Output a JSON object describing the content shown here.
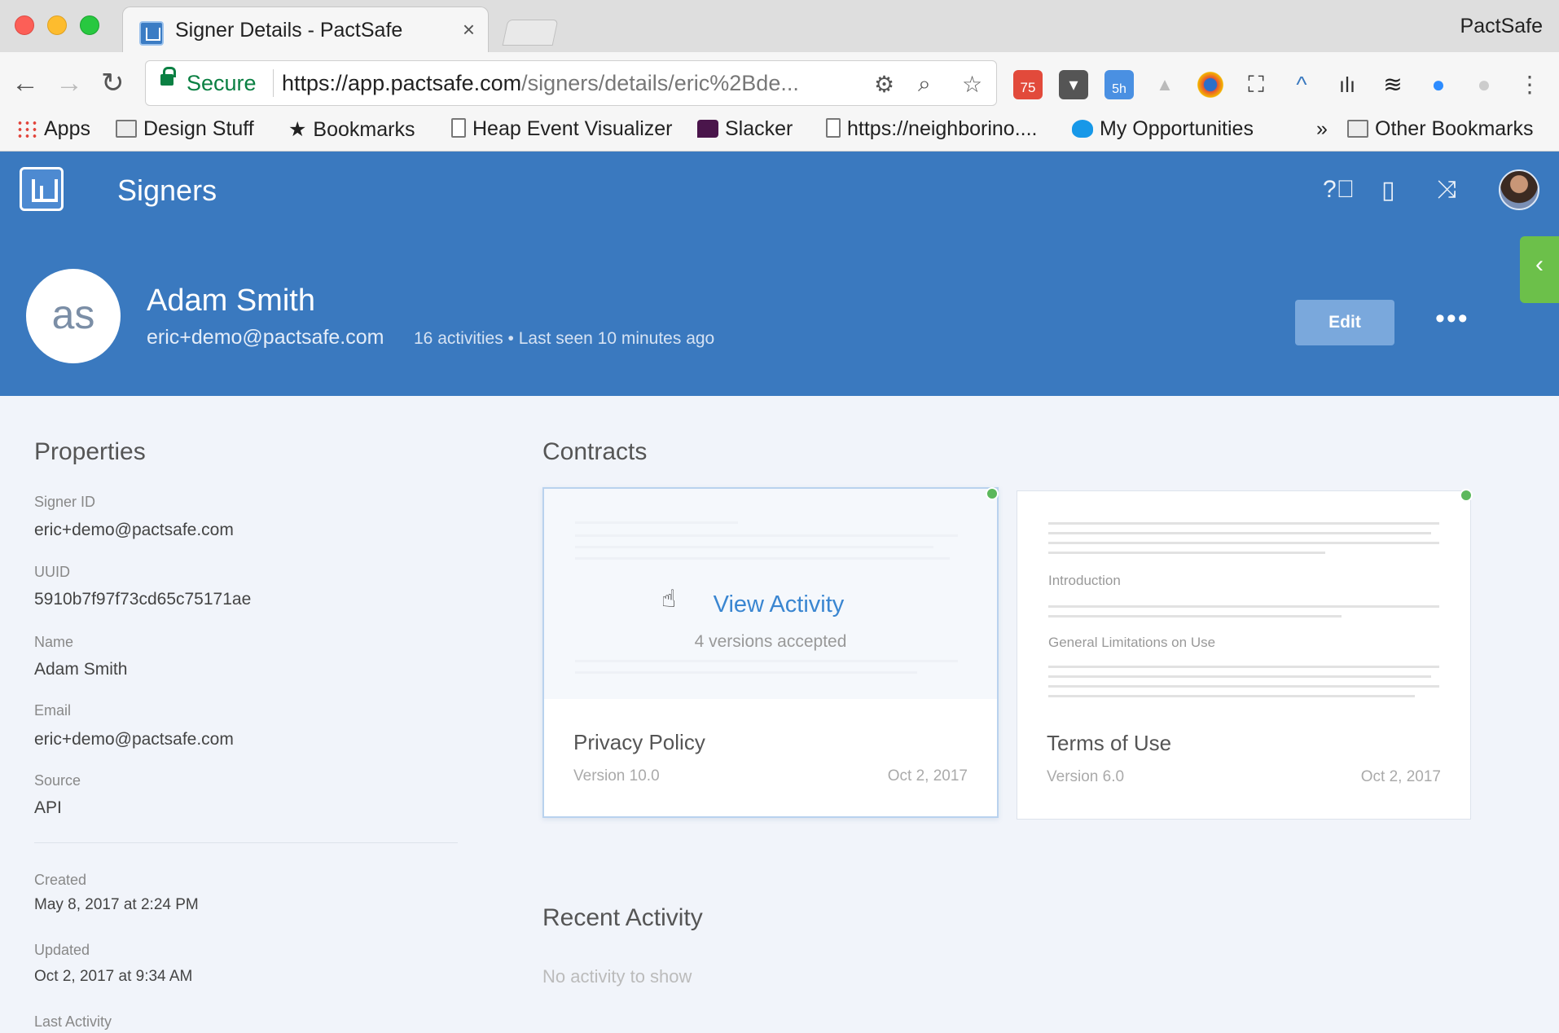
{
  "browser": {
    "tab_title": "Signer Details - PactSafe",
    "tab_close": "×",
    "profile_name": "PactSafe",
    "secure_label": "Secure",
    "url_host": "https://app.pactsafe.com",
    "url_path": "/signers/details/eric%2Bde...",
    "extension_badge_calendar": "75",
    "extension_badge_timer": "5h",
    "bookmarks": {
      "apps": "Apps",
      "design": "Design Stuff",
      "bookmarks": "Bookmarks",
      "heap": "Heap Event Visualizer",
      "slacker": "Slacker",
      "neighbor": "https://neighborino....",
      "opps": "My Opportunities",
      "overflow": "»",
      "other": "Other Bookmarks"
    }
  },
  "app": {
    "title": "Signers",
    "brand_color": "#3a79bf"
  },
  "profile": {
    "initials": "as",
    "name": "Adam Smith",
    "email": "eric+demo@pactsafe.com",
    "meta": "16 activities  •  Last seen 10 minutes ago",
    "edit_label": "Edit",
    "more_label": "•••"
  },
  "properties": {
    "title": "Properties",
    "items": [
      {
        "label": "Signer ID",
        "value": "eric+demo@pactsafe.com"
      },
      {
        "label": "UUID",
        "value": "5910b7f97f73cd65c75171ae"
      },
      {
        "label": "Name",
        "value": "Adam Smith"
      },
      {
        "label": "Email",
        "value": "eric+demo@pactsafe.com"
      },
      {
        "label": "Source",
        "value": "API"
      },
      {
        "label": "Created",
        "value": "May 8, 2017 at 2:24 PM"
      },
      {
        "label": "Updated",
        "value": "Oct 2, 2017 at 9:34 AM"
      },
      {
        "label": "Last Activity",
        "value": ""
      }
    ]
  },
  "contracts": {
    "title": "Contracts",
    "cards": [
      {
        "title": "Privacy Policy",
        "version": "Version 10.0",
        "date": "Oct 2, 2017",
        "hover_action": "View Activity",
        "hover_sub": "4 versions accepted",
        "status_color": "#5cb85c"
      },
      {
        "title": "Terms of Use",
        "version": "Version 6.0",
        "date": "Oct 2, 2017",
        "preview_heading_1": "Introduction",
        "preview_heading_2": "General Limitations on Use",
        "status_color": "#5cb85c"
      }
    ]
  },
  "recent_activity": {
    "title": "Recent Activity",
    "empty": "No activity to show"
  }
}
